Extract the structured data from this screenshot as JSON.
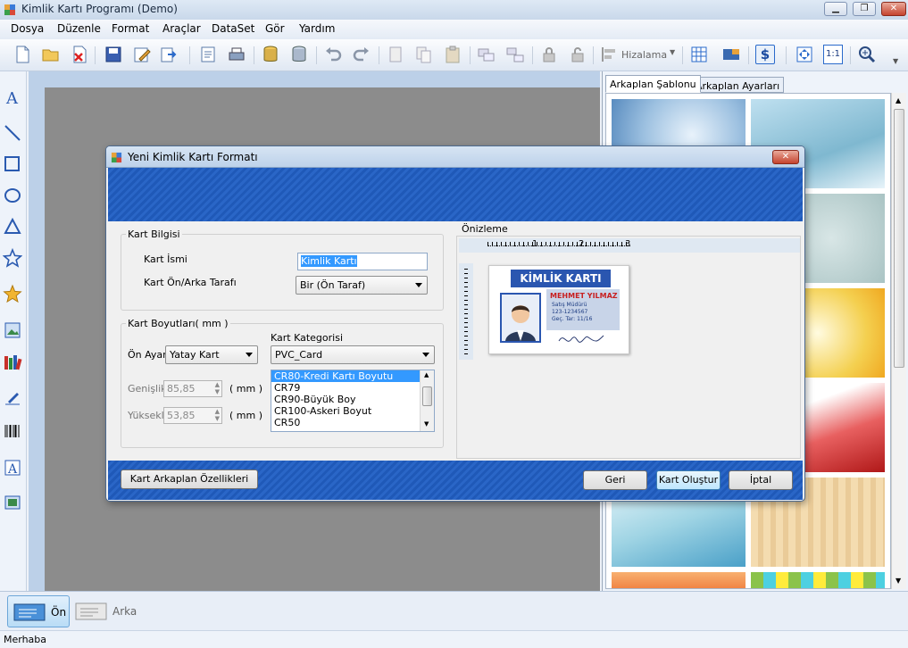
{
  "window": {
    "title": "Kimlik Kartı Programı (Demo)",
    "min": "▁",
    "max": "❐",
    "close": "✕"
  },
  "menu": {
    "items": [
      "Dosya",
      "Düzenle",
      "Format",
      "Araçlar",
      "DataSet",
      "Gör",
      "Yardım"
    ]
  },
  "toolbar": {
    "align_label": "Hizalama",
    "zoom_11": "1:1",
    "dollar": "$"
  },
  "right_panel": {
    "tabs": [
      "Arkaplan Şablonu",
      "Arkaplan Ayarları"
    ]
  },
  "bottom": {
    "front_label": "Ön",
    "back_label": "Arka"
  },
  "status": {
    "text": "Merhaba"
  },
  "dialog": {
    "title": "Yeni Kimlik Kartı Formatı",
    "close": "✕",
    "card_info": {
      "legend": "Kart Bilgisi",
      "name_label": "Kart İsmi",
      "name_value": "Kimlik Kartı",
      "side_label": "Kart Ön/Arka Tarafı",
      "side_value": "Bir (Ön Taraf)"
    },
    "card_size": {
      "legend": "Kart Boyutları( mm )",
      "orientation_label": "Ön Ayarl",
      "orientation_value": "Yatay Kart",
      "category_label": "Kart Kategorisi",
      "category_value": "PVC_Card",
      "width_label": "Genişlik:",
      "width_value": "85,85",
      "height_label": "Yükseklik",
      "height_value": "53,85",
      "unit": "( mm )",
      "sizes": [
        "CR80-Kredi Kartı Boyutu",
        "CR79",
        "CR90-Büyük Boy",
        "CR100-Askeri Boyut",
        "CR50"
      ],
      "selected_index": 0
    },
    "preview": {
      "legend": "Önizleme",
      "ruler": [
        "1",
        "2",
        "3"
      ],
      "card_title": "KİMLİK KARTI",
      "person_name": "MEHMET YILMAZ",
      "lines": [
        "Satış Müdürü",
        "123-1234567",
        "Geç. Tar: 11/16"
      ]
    },
    "buttons": {
      "background": "Kart Arkaplan Özellikleri",
      "back": "Geri",
      "create": "Kart Oluştur",
      "cancel": "İptal"
    }
  }
}
